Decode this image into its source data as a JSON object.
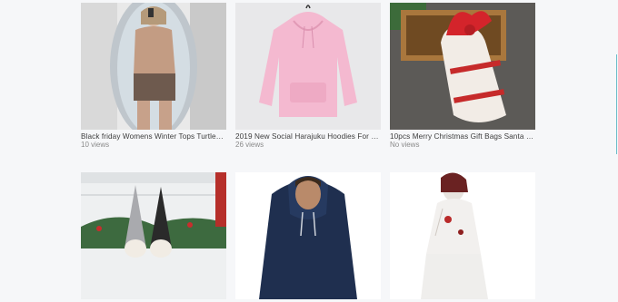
{
  "products": [
    {
      "title": "Black friday Womens Winter Tops Turtlene...",
      "views": "10 views",
      "icon": "woman-sweater-photo"
    },
    {
      "title": "2019 New Social Harajuku Hoodies For Gi...",
      "views": "26 views",
      "icon": "pink-hoodie-photo"
    },
    {
      "title": "10pcs Merry Christmas Gift Bags Santa Cl...",
      "views": "No views",
      "icon": "christmas-gift-bag-photo"
    },
    {
      "title": "",
      "views": "",
      "icon": "christmas-gnomes-photo"
    },
    {
      "title": "",
      "views": "",
      "icon": "navy-hoodie-man-photo"
    },
    {
      "title": "",
      "views": "",
      "icon": "zombie-costume-photo"
    }
  ],
  "colors": {
    "background": "#f6f7f9",
    "title_text": "#3d3d3d",
    "views_text": "#8a8a8a",
    "accent_scroll": "#6bbcc9"
  }
}
